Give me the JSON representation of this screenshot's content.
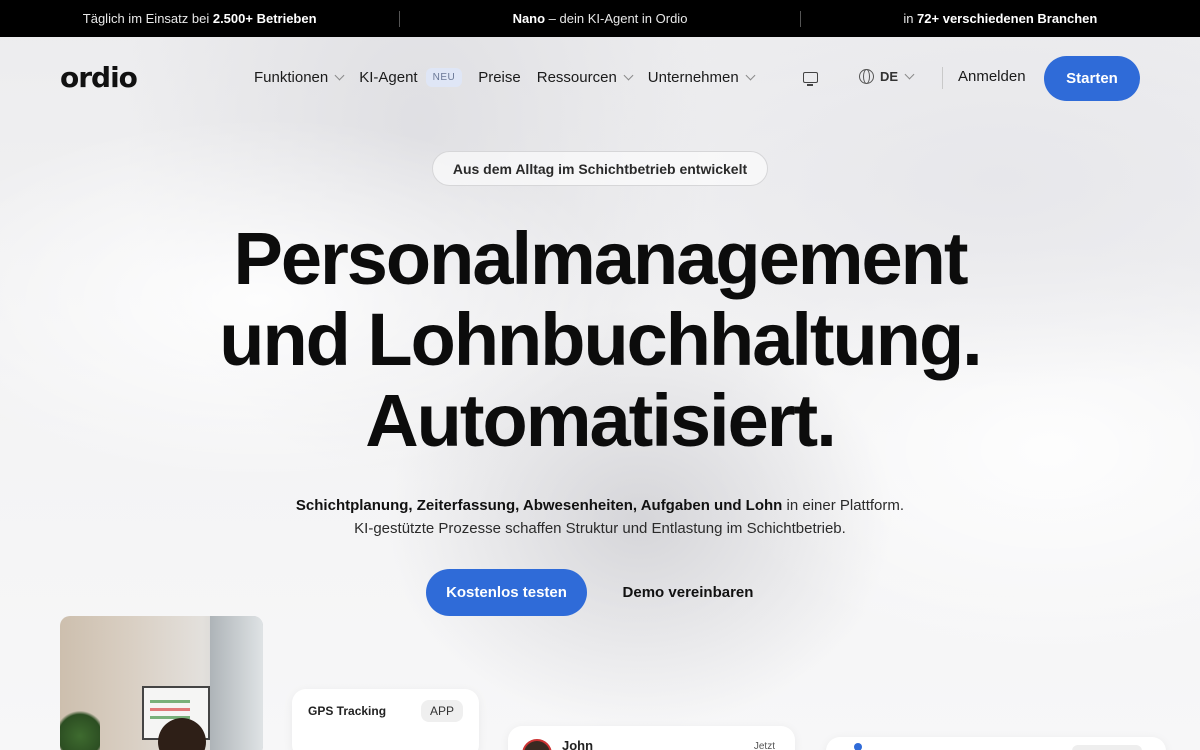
{
  "topbar": {
    "seg1_pre": "Täglich im Einsatz bei ",
    "seg1_bold": "2.500+ Betrieben",
    "seg2_bold": "Nano",
    "seg2_post": " – dein KI-Agent in Ordio",
    "seg3_pre": "in ",
    "seg3_bold": "72+ verschiedenen Branchen"
  },
  "nav": {
    "logo": "ordio",
    "items": [
      {
        "label": "Funktionen"
      },
      {
        "label": "KI-Agent",
        "badge": "NEU"
      },
      {
        "label": "Preise"
      },
      {
        "label": "Ressourcen"
      },
      {
        "label": "Unternehmen"
      }
    ],
    "language": "DE",
    "login": "Anmelden",
    "start": "Starten"
  },
  "hero": {
    "pill": "Aus dem Alltag im Schichtbetrieb entwickelt",
    "headline": [
      "Personalmanagement",
      "und Lohnbuchhaltung.",
      "Automatisiert."
    ],
    "sub_bold": "Schichtplanung, Zeiterfassung, Abwesenheiten, Aufgaben und Lohn",
    "sub_rest": " in einer Plattform. KI-gestützte Prozesse schaffen Struktur und Entlastung im Schichtbetrieb.",
    "cta_primary": "Kostenlos testen",
    "cta_secondary": "Demo vereinbaren"
  },
  "cards": {
    "gps_title": "GPS Tracking",
    "gps_badge": "APP",
    "john_name": "John",
    "john_time": "Jetzt"
  },
  "colors": {
    "accent": "#2f6bd8",
    "topbar_bg": "#000000"
  }
}
